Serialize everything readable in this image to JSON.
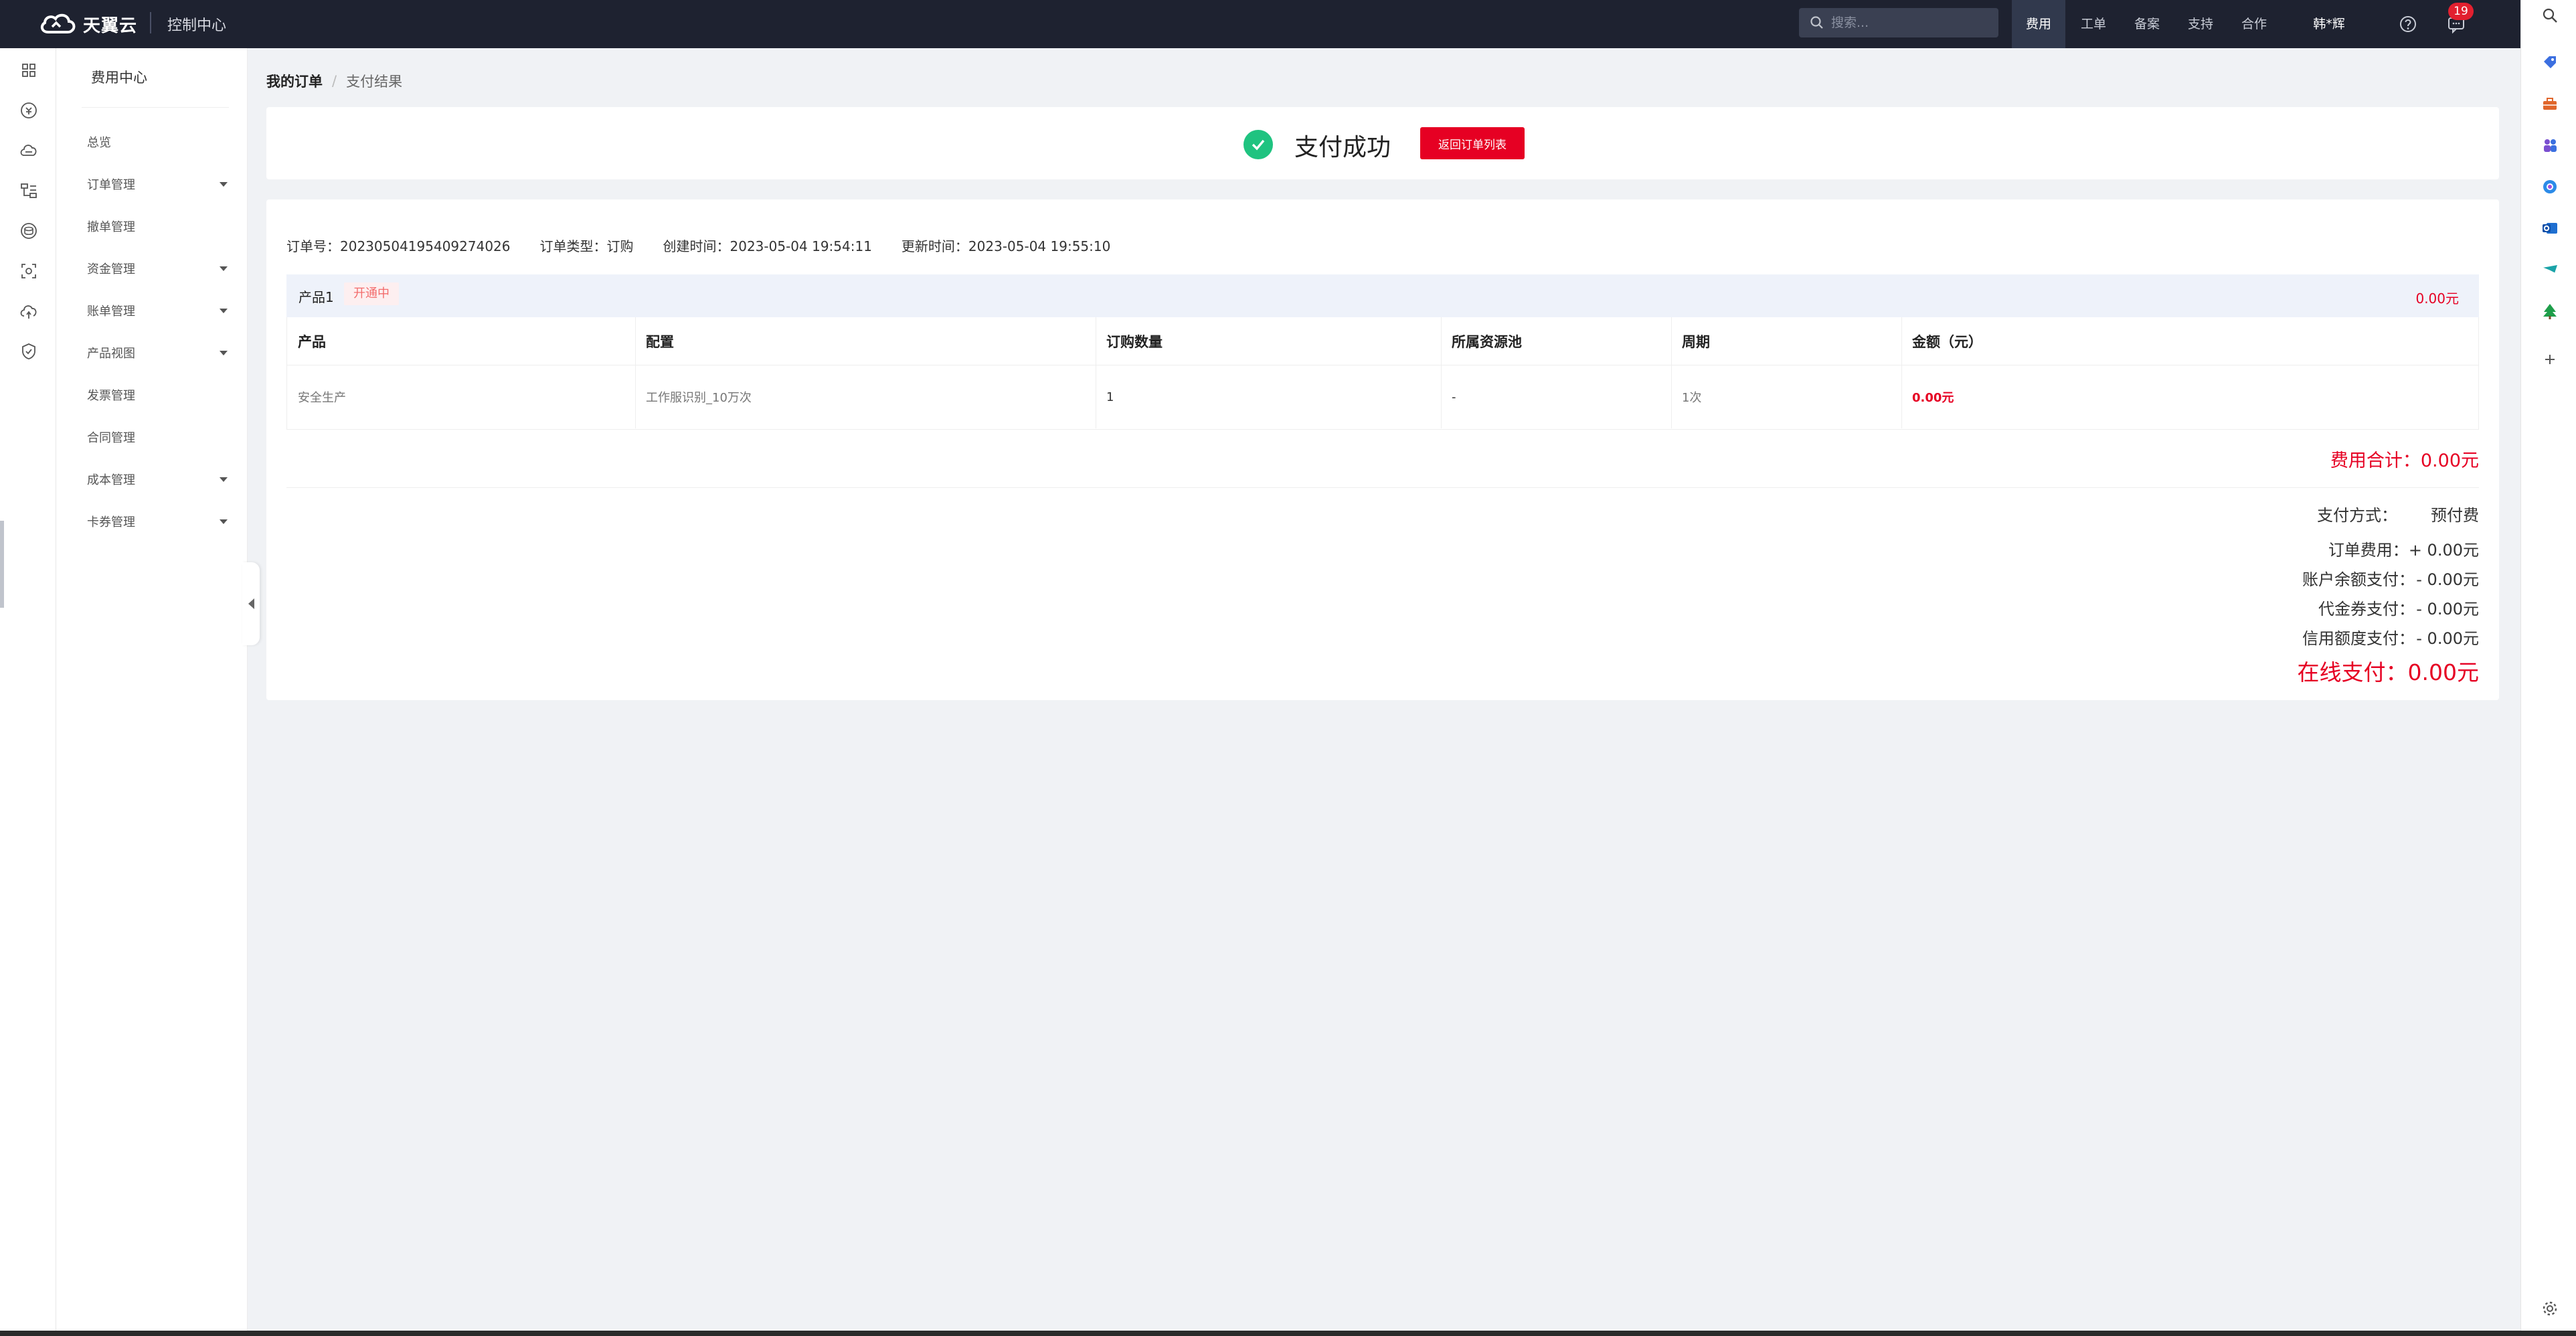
{
  "brand": {
    "logo_text": "天翼云",
    "console": "控制中心"
  },
  "search": {
    "placeholder": "搜索..."
  },
  "topnav": [
    "费用",
    "工单",
    "备案",
    "支持",
    "合作"
  ],
  "user": {
    "name": "韩*辉"
  },
  "notifications": {
    "count": "19"
  },
  "menu": {
    "title": "费用中心",
    "items": [
      {
        "label": "总览",
        "caret": false
      },
      {
        "label": "订单管理",
        "caret": true
      },
      {
        "label": "撤单管理",
        "caret": false
      },
      {
        "label": "资金管理",
        "caret": true
      },
      {
        "label": "账单管理",
        "caret": true
      },
      {
        "label": "产品视图",
        "caret": true
      },
      {
        "label": "发票管理",
        "caret": false
      },
      {
        "label": "合同管理",
        "caret": false
      },
      {
        "label": "成本管理",
        "caret": true
      },
      {
        "label": "卡券管理",
        "caret": true
      }
    ]
  },
  "breadcrumb": {
    "current": "我的订单",
    "separator": "/",
    "leaf": "支付结果"
  },
  "success": {
    "text": "支付成功",
    "button": "返回订单列表"
  },
  "order": {
    "number_label": "订单号：",
    "number": "20230504195409274026",
    "type_label": "订单类型：",
    "type": "订购",
    "created_label": "创建时间：",
    "created": "2023-05-04 19:54:11",
    "updated_label": "更新时间：",
    "updated": "2023-05-04 19:55:10"
  },
  "product": {
    "name": "产品1",
    "status": "开通中",
    "amount": "0.00元"
  },
  "table": {
    "headers": [
      "产品",
      "配置",
      "订购数量",
      "所属资源池",
      "周期",
      "金额（元）"
    ],
    "row": [
      "安全生产",
      "工作服识别_10万次",
      "1",
      "-",
      "1次",
      "0.00元"
    ]
  },
  "total": "费用合计：0.00元",
  "payment": {
    "method_label": "支付方式：",
    "method": "预付费",
    "order_fee_label": "订单费用：",
    "order_fee": "+ 0.00元",
    "balance_label": "账户余额支付：",
    "balance": "- 0.00元",
    "voucher_label": "代金券支付：",
    "voucher": "- 0.00元",
    "credit_label": "信用额度支付：",
    "credit": "- 0.00元",
    "online": "在线支付：0.00元"
  },
  "colors": {
    "accent": "#e60023",
    "success": "#1fc380",
    "topbar": "#1e2230"
  }
}
